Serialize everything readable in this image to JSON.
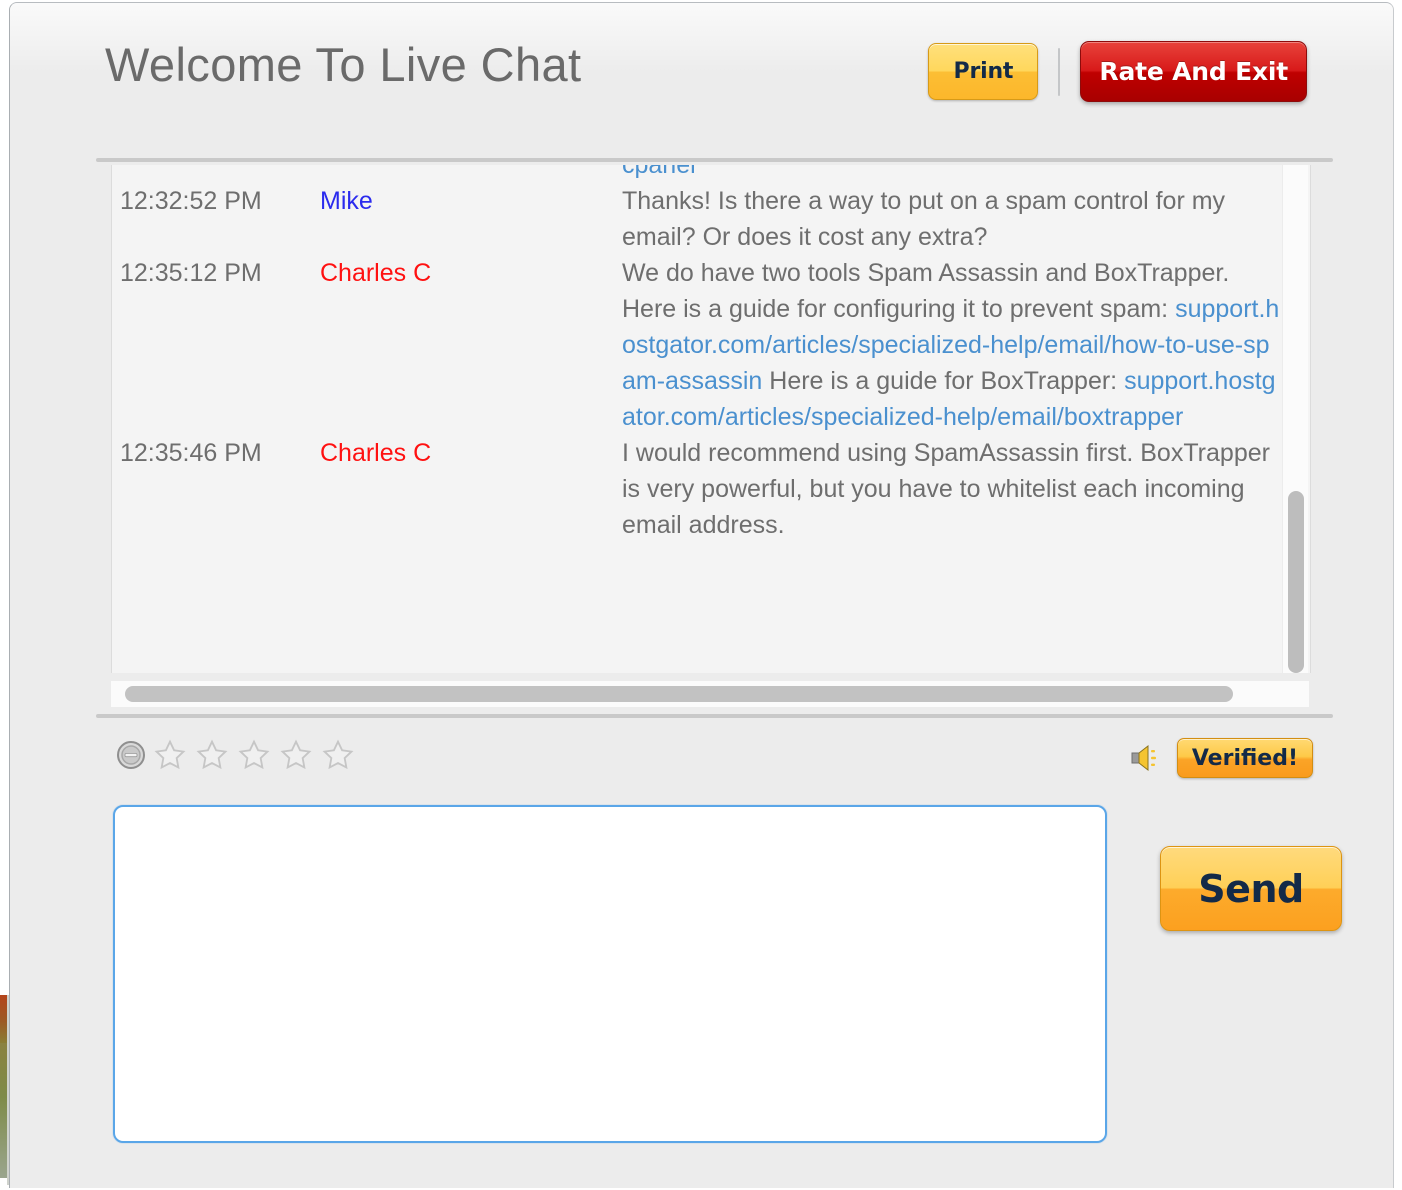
{
  "window": {
    "title": "Welcome To Live Chat"
  },
  "header": {
    "print_label": "Print",
    "rate_exit_label": "Rate And Exit"
  },
  "transcript": {
    "partial_top_message": "cpanel",
    "rows": [
      {
        "time": "12:32:52 PM",
        "name": "Mike",
        "role": "visitor",
        "message": "Thanks! Is there a way to put on a spam control for my email? Or does it cost any extra?"
      },
      {
        "time": "12:35:12 PM",
        "name": "Charles C",
        "role": "agent",
        "message_part1": "We do have two tools Spam Assassin and BoxTrapper. Here is a guide for configuring it to prevent spam: ",
        "link1": "support.hostgator.com/articles/specialized-help/email/how-to-use-spam-assassin",
        "message_part2": " Here is a guide for BoxTrapper: ",
        "link2": "support.hostgator.com/articles/specialized-help/email/boxtrapper"
      },
      {
        "time": "12:35:46 PM",
        "name": "Charles C",
        "role": "agent",
        "message": "I would recommend using SpamAssassin first. BoxTrapper is very powerful, but you have to whitelist each incoming email address."
      }
    ]
  },
  "rating": {
    "clear_icon": "minus-circle-icon",
    "stars_total": 5,
    "stars_filled": 0,
    "star_icon": "star-outline-icon"
  },
  "status": {
    "sound_icon": "speaker-icon",
    "verified_label": "Verified!"
  },
  "compose": {
    "message_value": "",
    "message_placeholder": "",
    "send_label": "Send"
  },
  "colors": {
    "accent_amber": "#fcb72b",
    "accent_red": "#c60000",
    "link_blue": "#4a90cf",
    "visitor_name": "#2b2bee",
    "agent_name": "#ff1111",
    "input_focus_border": "#5aa6e8",
    "window_bg": "#ececec"
  }
}
